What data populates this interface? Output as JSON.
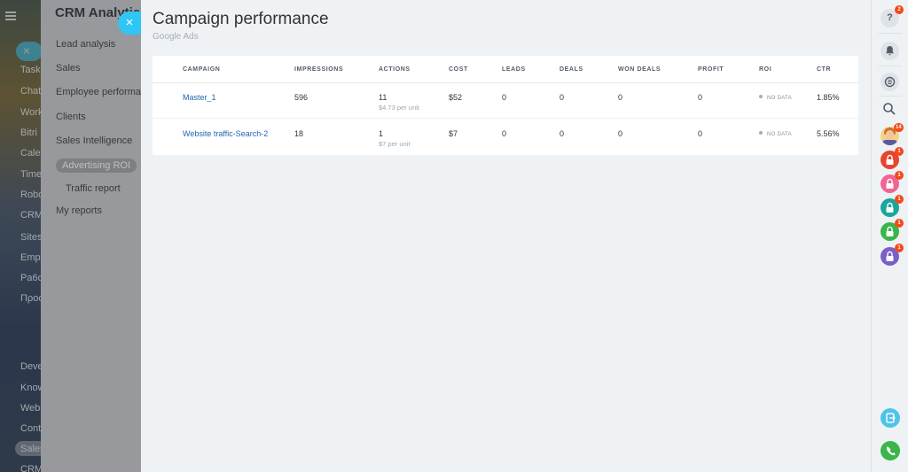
{
  "app_sidebar": {
    "items": [
      "Task",
      "Chat",
      "Work",
      "Bitri",
      "Cale",
      "Time",
      "Robo",
      "CRM",
      "Sites",
      "Emp",
      "Pa6c",
      "Προσ",
      "Deve",
      "Know",
      "Web",
      "Cont",
      "Sales",
      "CRM"
    ]
  },
  "menu": {
    "title": "CRM Analytics",
    "items": {
      "lead_analysis": "Lead analysis",
      "sales": "Sales",
      "employee_performance": "Employee performance",
      "clients": "Clients",
      "sales_intelligence": "Sales Intelligence",
      "advertising_roi": "Advertising ROI",
      "traffic_report": "Traffic report",
      "my_reports": "My reports"
    }
  },
  "slider": {
    "close_glyph": "×"
  },
  "page": {
    "title": "Campaign performance",
    "subtitle": "Google Ads"
  },
  "table": {
    "headers": {
      "campaign": "CAMPAIGN",
      "impressions": "IMPRESSIONS",
      "actions": "ACTIONS",
      "cost": "COST",
      "leads": "LEADS",
      "deals": "DEALS",
      "won_deals": "WON DEALS",
      "profit": "PROFIT",
      "roi": "ROI",
      "ctr": "CTR"
    },
    "rows": [
      {
        "campaign": "Master_1",
        "impressions": "596",
        "actions": "11",
        "actions_sub": "$4.73 per unit",
        "cost": "$52",
        "leads": "0",
        "deals": "0",
        "won_deals": "0",
        "profit": "0",
        "roi": "NO DATA",
        "ctr": "1.85%"
      },
      {
        "campaign": "Website traffic-Search-2",
        "impressions": "18",
        "actions": "1",
        "actions_sub": "$7 per unit",
        "cost": "$7",
        "leads": "0",
        "deals": "0",
        "won_deals": "0",
        "profit": "0",
        "roi": "NO DATA",
        "ctr": "5.56%"
      }
    ]
  },
  "right_bar": {
    "help_badge": "2",
    "help_glyph": "?",
    "avatar_badge": "14",
    "lock_badges": [
      "1",
      "1",
      "1",
      "1",
      "1"
    ],
    "lock_colors": [
      "#e8452c",
      "#f06596",
      "#1aa69c",
      "#3ab54a",
      "#7a5fc8"
    ],
    "chat_icon_color": "#4fc3e8",
    "phone_color": "#3ab54a"
  },
  "colors": {
    "accent": "#2fc6f6",
    "link": "#2067b0",
    "badge": "#f54819"
  }
}
